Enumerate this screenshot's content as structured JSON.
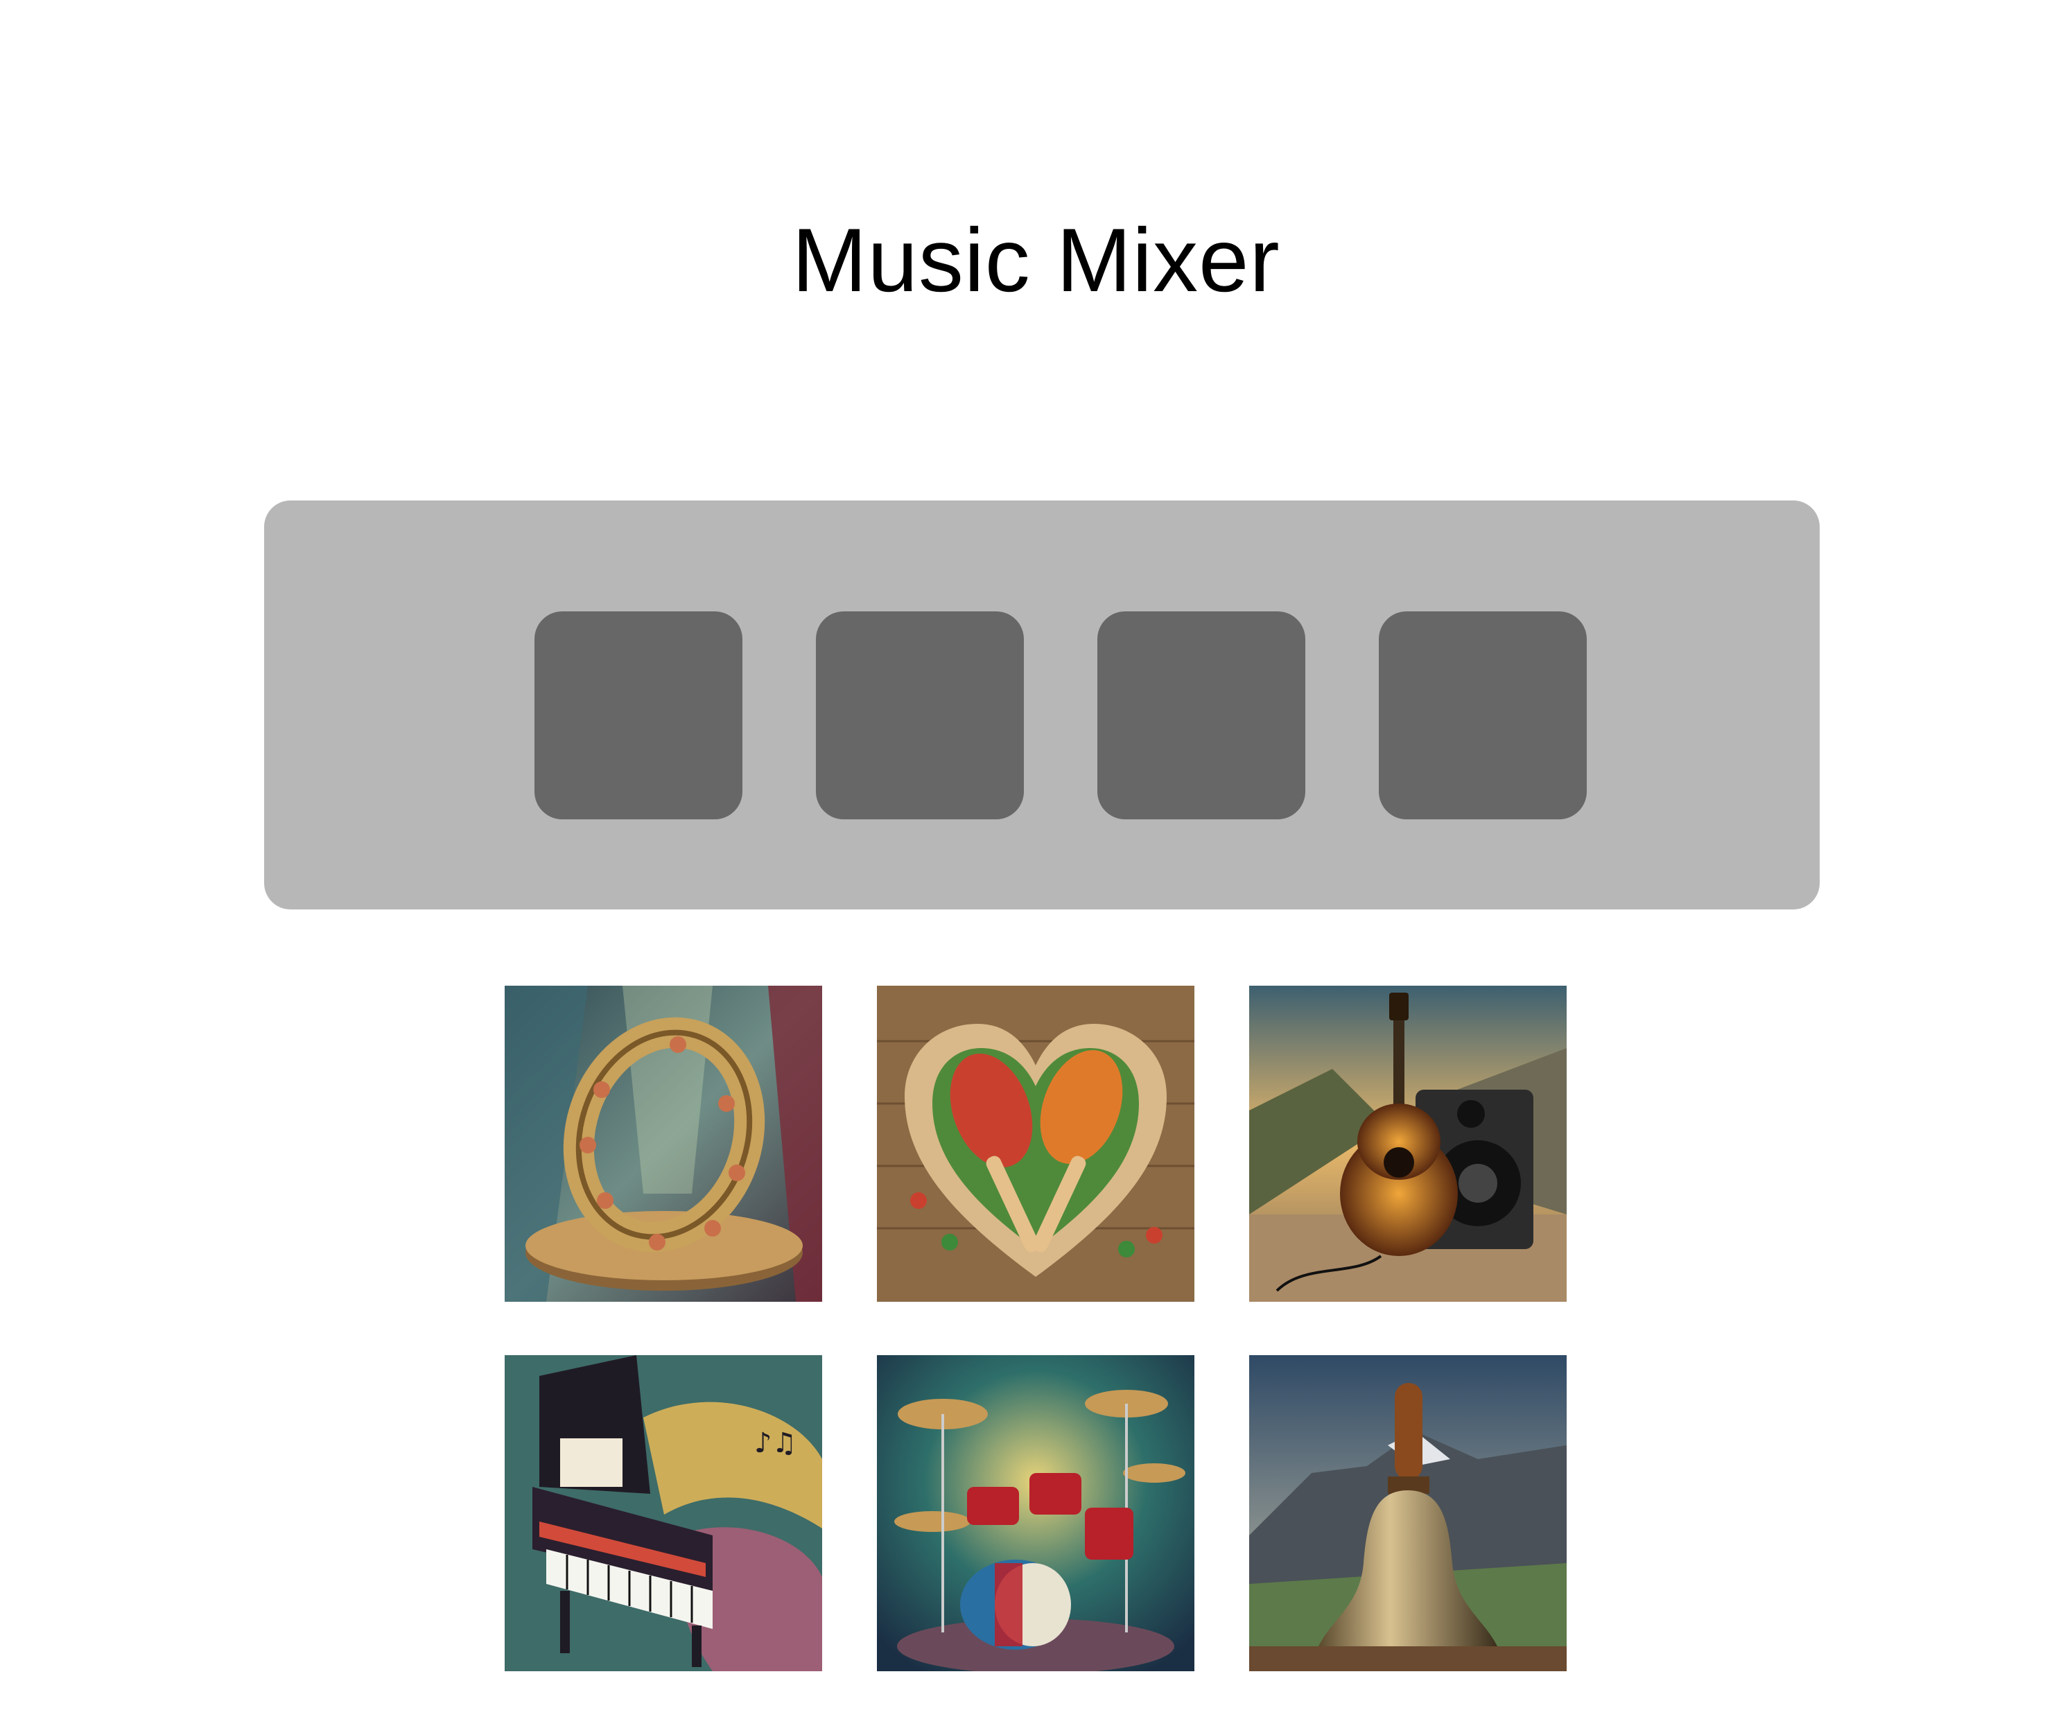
{
  "title": "Music Mixer",
  "mixer": {
    "slot_count": 4,
    "slot_color": "#676767",
    "panel_color": "#b7b7b7"
  },
  "instruments": [
    {
      "name": "tambourine-icon"
    },
    {
      "name": "maracas-icon"
    },
    {
      "name": "acoustic-guitar-icon"
    },
    {
      "name": "grand-piano-icon"
    },
    {
      "name": "drum-kit-icon"
    },
    {
      "name": "hand-bell-icon"
    }
  ]
}
